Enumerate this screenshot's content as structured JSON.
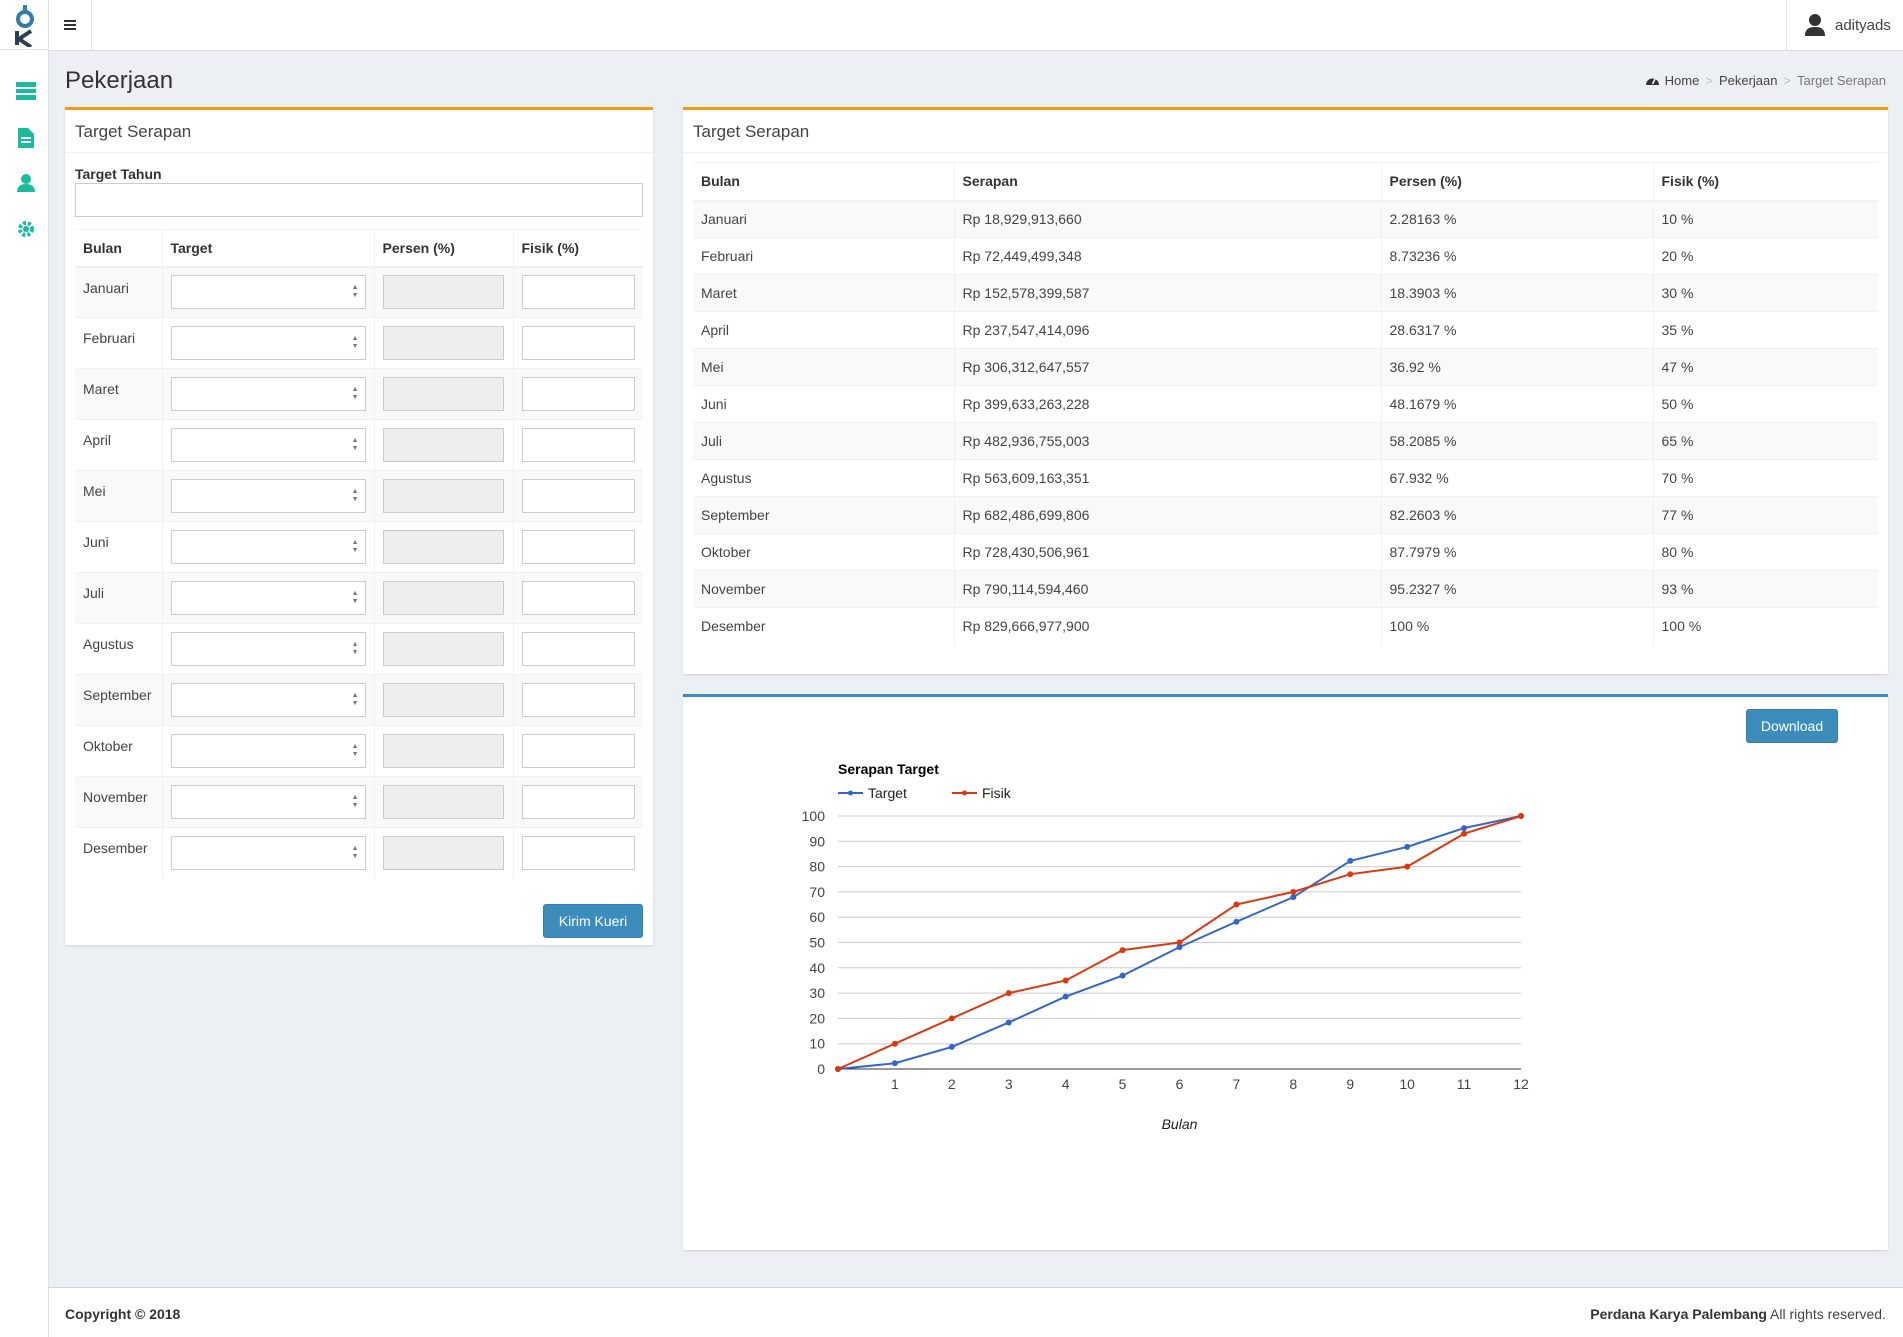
{
  "topbar": {
    "username": "adityads"
  },
  "page": {
    "title": "Pekerjaan"
  },
  "breadcrumb": {
    "home": "Home",
    "parent": "Pekerjaan",
    "current": "Target Serapan"
  },
  "form": {
    "title": "Target Serapan",
    "year_label": "Target Tahun",
    "columns": [
      "Bulan",
      "Target",
      "Persen (%)",
      "Fisik (%)"
    ],
    "months": [
      "Januari",
      "Februari",
      "Maret",
      "April",
      "Mei",
      "Juni",
      "Juli",
      "Agustus",
      "September",
      "Oktober",
      "November",
      "Desember"
    ],
    "submit_label": "Kirim Kueri"
  },
  "results": {
    "title": "Target Serapan",
    "columns": [
      "Bulan",
      "Serapan",
      "Persen (%)",
      "Fisik (%)"
    ],
    "rows": [
      [
        "Januari",
        "Rp 18,929,913,660",
        "2.28163 %",
        "10 %"
      ],
      [
        "Februari",
        "Rp 72,449,499,348",
        "8.73236 %",
        "20 %"
      ],
      [
        "Maret",
        "Rp 152,578,399,587",
        "18.3903 %",
        "30 %"
      ],
      [
        "April",
        "Rp 237,547,414,096",
        "28.6317 %",
        "35 %"
      ],
      [
        "Mei",
        "Rp 306,312,647,557",
        "36.92 %",
        "47 %"
      ],
      [
        "Juni",
        "Rp 399,633,263,228",
        "48.1679 %",
        "50 %"
      ],
      [
        "Juli",
        "Rp 482,936,755,003",
        "58.2085 %",
        "65 %"
      ],
      [
        "Agustus",
        "Rp 563,609,163,351",
        "67.932 %",
        "70 %"
      ],
      [
        "September",
        "Rp 682,486,699,806",
        "82.2603 %",
        "77 %"
      ],
      [
        "Oktober",
        "Rp 728,430,506,961",
        "87.7979 %",
        "80 %"
      ],
      [
        "November",
        "Rp 790,114,594,460",
        "95.2327 %",
        "93 %"
      ],
      [
        "Desember",
        "Rp 829,666,977,900",
        "100 %",
        "100 %"
      ]
    ]
  },
  "chart_panel": {
    "download_label": "Download"
  },
  "chart_data": {
    "type": "line",
    "title": "Serapan Target",
    "xlabel": "Bulan",
    "ylabel": "",
    "x": [
      0,
      1,
      2,
      3,
      4,
      5,
      6,
      7,
      8,
      9,
      10,
      11,
      12
    ],
    "x_ticks": [
      "1",
      "2",
      "3",
      "4",
      "5",
      "6",
      "7",
      "8",
      "9",
      "10",
      "11",
      "12"
    ],
    "ylim": [
      0,
      100
    ],
    "y_ticks": [
      0,
      10,
      20,
      30,
      40,
      50,
      60,
      70,
      80,
      90,
      100
    ],
    "grid": true,
    "legend_position": "top-left",
    "series": [
      {
        "name": "Target",
        "color": "#3366cc",
        "values": [
          0,
          2.28,
          8.73,
          18.39,
          28.63,
          36.92,
          48.17,
          58.21,
          67.93,
          82.26,
          87.8,
          95.23,
          100
        ]
      },
      {
        "name": "Fisik",
        "color": "#dc3912",
        "values": [
          0,
          10,
          20,
          30,
          35,
          47,
          50,
          65,
          70,
          77,
          80,
          93,
          100
        ]
      }
    ]
  },
  "footer": {
    "copyright": "Copyright © 2018",
    "company": "Perdana Karya Palembang",
    "rights": " All rights reserved."
  },
  "colors": {
    "accent_orange": "#f39c12",
    "accent_blue": "#3c8dbc",
    "sidebar_icon": "#1abc9c"
  }
}
